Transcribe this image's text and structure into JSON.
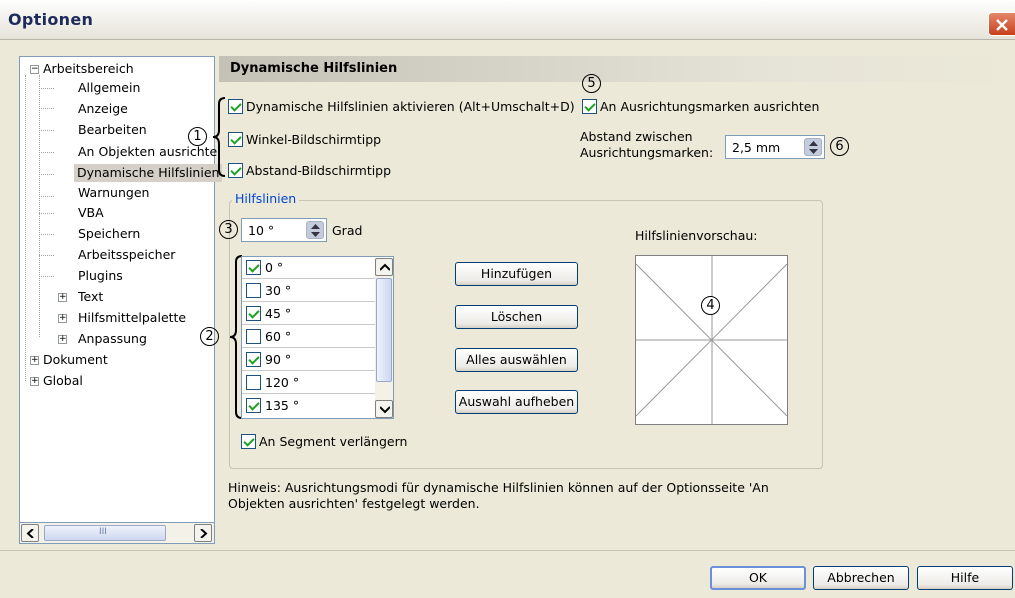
{
  "window": {
    "title": "Optionen"
  },
  "tree": {
    "items": [
      {
        "label": "Arbeitsbereich",
        "expander": "−"
      },
      {
        "label": "Allgemein"
      },
      {
        "label": "Anzeige"
      },
      {
        "label": "Bearbeiten"
      },
      {
        "label": "An Objekten ausrichte"
      },
      {
        "label": "Dynamische Hilfslinien"
      },
      {
        "label": "Warnungen"
      },
      {
        "label": "VBA"
      },
      {
        "label": "Speichern"
      },
      {
        "label": "Arbeitsspeicher"
      },
      {
        "label": "Plugins"
      },
      {
        "label": "Text",
        "expander": "+"
      },
      {
        "label": "Hilfsmittelpalette",
        "expander": "+"
      },
      {
        "label": "Anpassung",
        "expander": "+"
      },
      {
        "label": "Dokument",
        "expander": "+"
      },
      {
        "label": "Global",
        "expander": "+"
      }
    ],
    "scroll_grip": "III"
  },
  "page": {
    "title": "Dynamische Hilfslinien",
    "enable_label": "Dynamische Hilfslinien aktivieren (Alt+Umschalt+D)",
    "angle_tip_label": "Winkel-Bildschirmtipp",
    "distance_tip_label": "Abstand-Bildschirmtipp",
    "snap_marks_label": "An Ausrichtungsmarken ausrichten",
    "spacing_label_1": "Abstand zwischen",
    "spacing_label_2": "Ausrichtungsmarken:",
    "spacing_value": "2,5 mm",
    "callouts": [
      "1",
      "2",
      "3",
      "4",
      "5",
      "6"
    ]
  },
  "guides": {
    "group_label": "Hilfslinien",
    "degree_value": "10 °",
    "degree_unit": "Grad",
    "angles": [
      {
        "label": "0 °",
        "checked": true
      },
      {
        "label": "30 °",
        "checked": false
      },
      {
        "label": "45 °",
        "checked": true
      },
      {
        "label": "60 °",
        "checked": false
      },
      {
        "label": "90 °",
        "checked": true
      },
      {
        "label": "120 °",
        "checked": false
      },
      {
        "label": "135 °",
        "checked": true
      }
    ],
    "add_button": "Hinzufügen",
    "delete_button": "Löschen",
    "select_all_button": "Alles auswählen",
    "deselect_button": "Auswahl aufheben",
    "preview_label": "Hilfslinienvorschau:",
    "extend_label": "An Segment verlängern"
  },
  "hint": {
    "line1": "Hinweis: Ausrichtungsmodi für dynamische Hilfslinien können auf der Optionsseite 'An",
    "line2": "Objekten ausrichten' festgelegt werden."
  },
  "footer": {
    "ok": "OK",
    "cancel": "Abbrechen",
    "help": "Hilfe"
  },
  "colors": {
    "accent": "#0046d5",
    "selection": "#d4d0c8",
    "dialog": "#ece9d8"
  }
}
